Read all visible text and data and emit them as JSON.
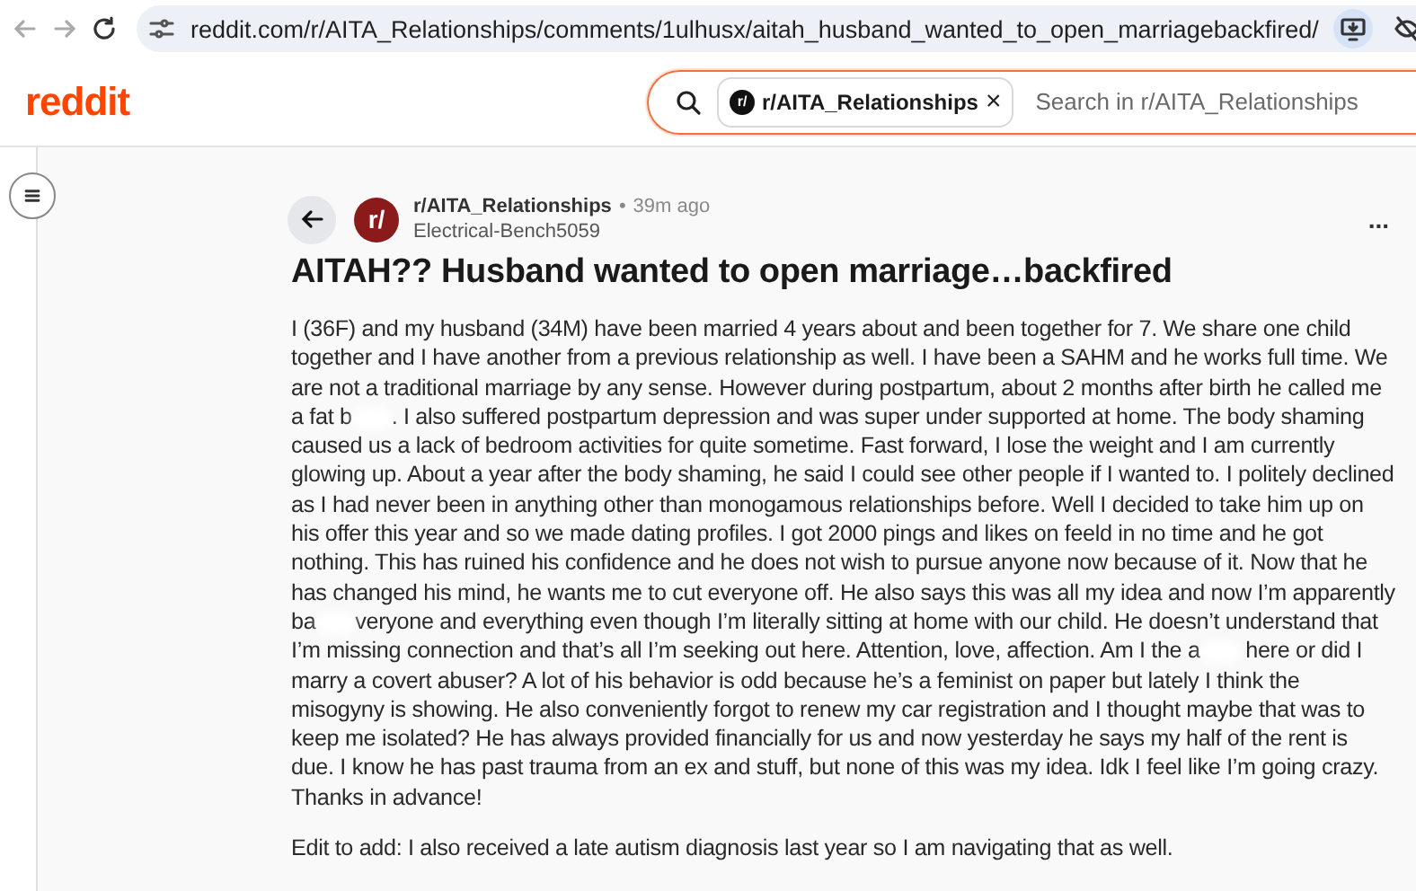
{
  "browser": {
    "url": "reddit.com/r/AITA_Relationships/comments/1ulhusx/aitah_husband_wanted_to_open_marriagebackfired/"
  },
  "header": {
    "logo": "reddit",
    "search": {
      "chip": {
        "icon_text": "r/",
        "label": "r/AITA_Relationships",
        "close": "×"
      },
      "placeholder": "Search in r/AITA_Relationships"
    }
  },
  "post": {
    "subreddit": "r/AITA_Relationships",
    "avatar_text": "r/",
    "separator": "•",
    "time": "39m ago",
    "author": "Electrical-Bench5059",
    "more": "...",
    "title": "AITAH?? Husband wanted to open marriage…backfired",
    "body": [
      {
        "segments": [
          "I (36F) and my husband (34M) have been married 4 years about and been together for 7. We share one child together and I have another from a previous relationship as well. I have been a SAHM and he works full time. We are not a traditional marriage by any sense. However during postpartum, about 2 months after birth he called me a fat b",
          ". I also suffered postpartum depression and was super under supported at home. The body shaming caused us a lack of bedroom activities for quite sometime. Fast forward, I lose the weight and I am currently glowing up. About a year after the body shaming, he said I could see other people if I wanted to. I politely declined as I had never been in anything other than monogamous relationships before. Well I decided to take him up on his offer this year and so we made dating profiles. I got 2000 pings and likes on feeld in no time and he got nothing. This has ruined his confidence and he does not wish to pursue anyone now because of it. Now that he has changed his mind, he wants me to cut everyone off. He also says this was all my idea and now I’m apparently ba",
          "veryone and everything even though I’m literally sitting at home with our child. He doesn’t understand that I’m missing connection and that’s all I’m seeking out here. Attention, love, affection. Am I the a",
          " here or did I marry a covert abuser? A lot of his behavior is odd because he’s a feminist on paper but lately I think the misogyny is showing. He also conveniently forgot to renew my car registration and I thought maybe that was to keep me isolated? He has always provided financially for us and now yesterday he says my half of the rent is due. I know he has past trauma from an ex and stuff, but none of this was my idea. Idk I feel like I’m going crazy. Thanks in advance!"
        ]
      },
      {
        "segments": [
          "Edit to add: I also received a late autism diagnosis last year so I am navigating that as well."
        ]
      }
    ]
  }
}
